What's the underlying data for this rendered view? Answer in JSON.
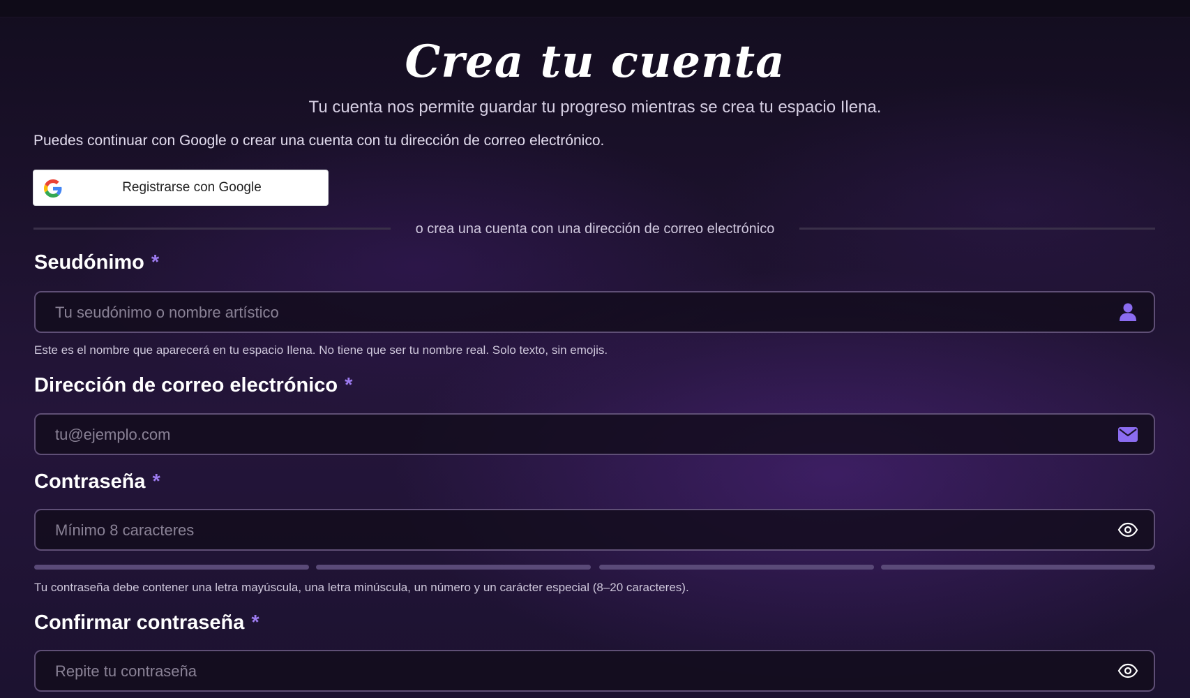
{
  "header": {
    "title": "Crea tu cuenta",
    "subtitle": "Tu cuenta nos permite guardar tu progreso mientras se crea tu espacio Ilena."
  },
  "intro_text": "Puedes continuar con Google o crear una cuenta con tu dirección de correo electrónico.",
  "google_button": {
    "label": "Registrarse con Google",
    "icon": "google-g-icon"
  },
  "divider_text": "o crea una cuenta con una dirección de correo electrónico",
  "required_marker": "*",
  "fields": {
    "pseudonym": {
      "label": "Seudónimo",
      "placeholder": "Tu seudónimo o nombre artístico",
      "value": "",
      "icon": "user-icon",
      "help": "Este es el nombre que aparecerá en tu espacio Ilena. No tiene que ser tu nombre real. Solo texto, sin emojis."
    },
    "email": {
      "label": "Dirección de correo electrónico",
      "placeholder": "tu@ejemplo.com",
      "value": "",
      "icon": "mail-icon"
    },
    "password": {
      "label": "Contraseña",
      "placeholder": "Mínimo 8 caracteres",
      "value": "",
      "icon": "eye-icon",
      "strength_segments_filled": 0,
      "strength_segments_total": 4,
      "help": "Tu contraseña debe contener una letra mayúscula, una letra minúscula, un número y un carácter especial (8–20 caracteres)."
    },
    "confirm_password": {
      "label": "Confirmar contraseña",
      "placeholder": "Repite tu contraseña",
      "value": "",
      "icon": "eye-icon"
    }
  },
  "colors": {
    "accent": "#9d7bf0",
    "icon": "#8b6cf0",
    "input_border": "#5f4f76",
    "strength_empty": "#5a4a78"
  }
}
